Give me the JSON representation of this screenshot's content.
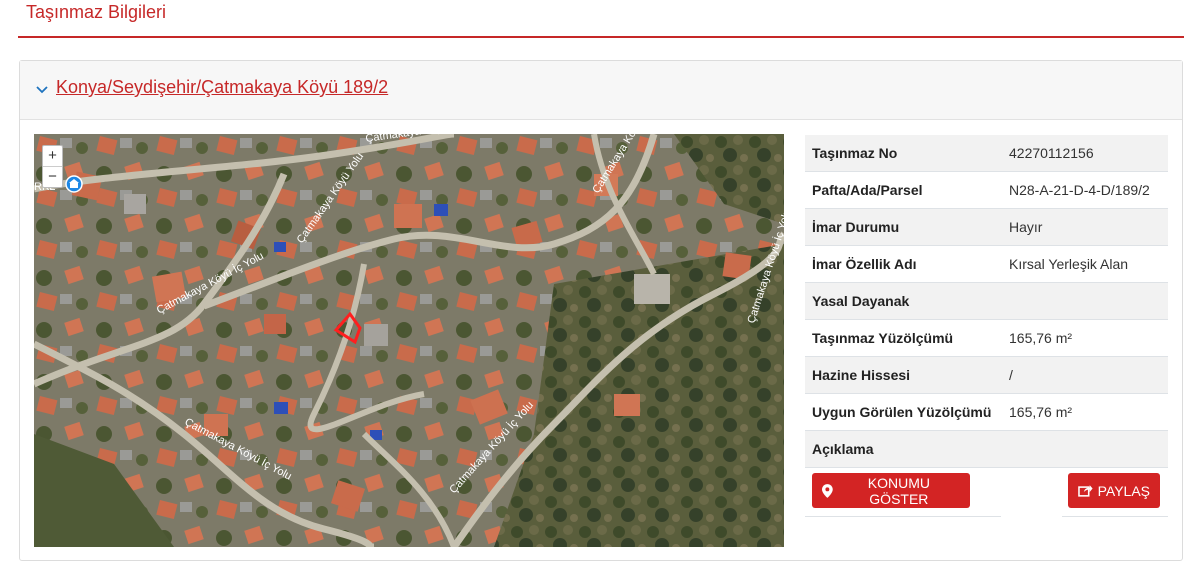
{
  "section": {
    "title": "Taşınmaz Bilgileri"
  },
  "card": {
    "title": "Konya/Seydişehir/Çatmakaya Köyü 189/2"
  },
  "map": {
    "zoom_in": "+",
    "zoom_out": "−",
    "corner_label": "RKL",
    "road_labels": [
      "Çatmakaya Köyü",
      "Çatmakaya Köyü Yolu",
      "Çatmakaya Köyü İç Yolu",
      "Çatmakaya Köyü İç Yolu",
      "Çatmakaya Köyü İç Yolu",
      "Çatmakaya Köyü İç Yolu",
      "Çatmakaya Köyü İç Yolu"
    ],
    "parcel_color": "#ff1f1f"
  },
  "info": {
    "rows": [
      {
        "label": "Taşınmaz No",
        "value": "42270112156"
      },
      {
        "label": "Pafta/Ada/Parsel",
        "value": "N28-A-21-D-4-D/189/2"
      },
      {
        "label": "İmar Durumu",
        "value": "Hayır"
      },
      {
        "label": "İmar Özellik Adı",
        "value": "Kırsal Yerleşik Alan"
      },
      {
        "label": "Yasal Dayanak",
        "value": ""
      },
      {
        "label": "Taşınmaz Yüzölçümü",
        "value": "165,76 m²"
      },
      {
        "label": "Hazine Hissesi",
        "value": "/"
      },
      {
        "label": "Uygun Görülen Yüzölçümü",
        "value": "165,76 m²"
      },
      {
        "label": "Açıklama",
        "value": ""
      }
    ]
  },
  "buttons": {
    "show_location": "KONUMU GÖSTER",
    "share": "PAYLAŞ"
  },
  "colors": {
    "accent": "#c62828",
    "button": "#d32424"
  }
}
